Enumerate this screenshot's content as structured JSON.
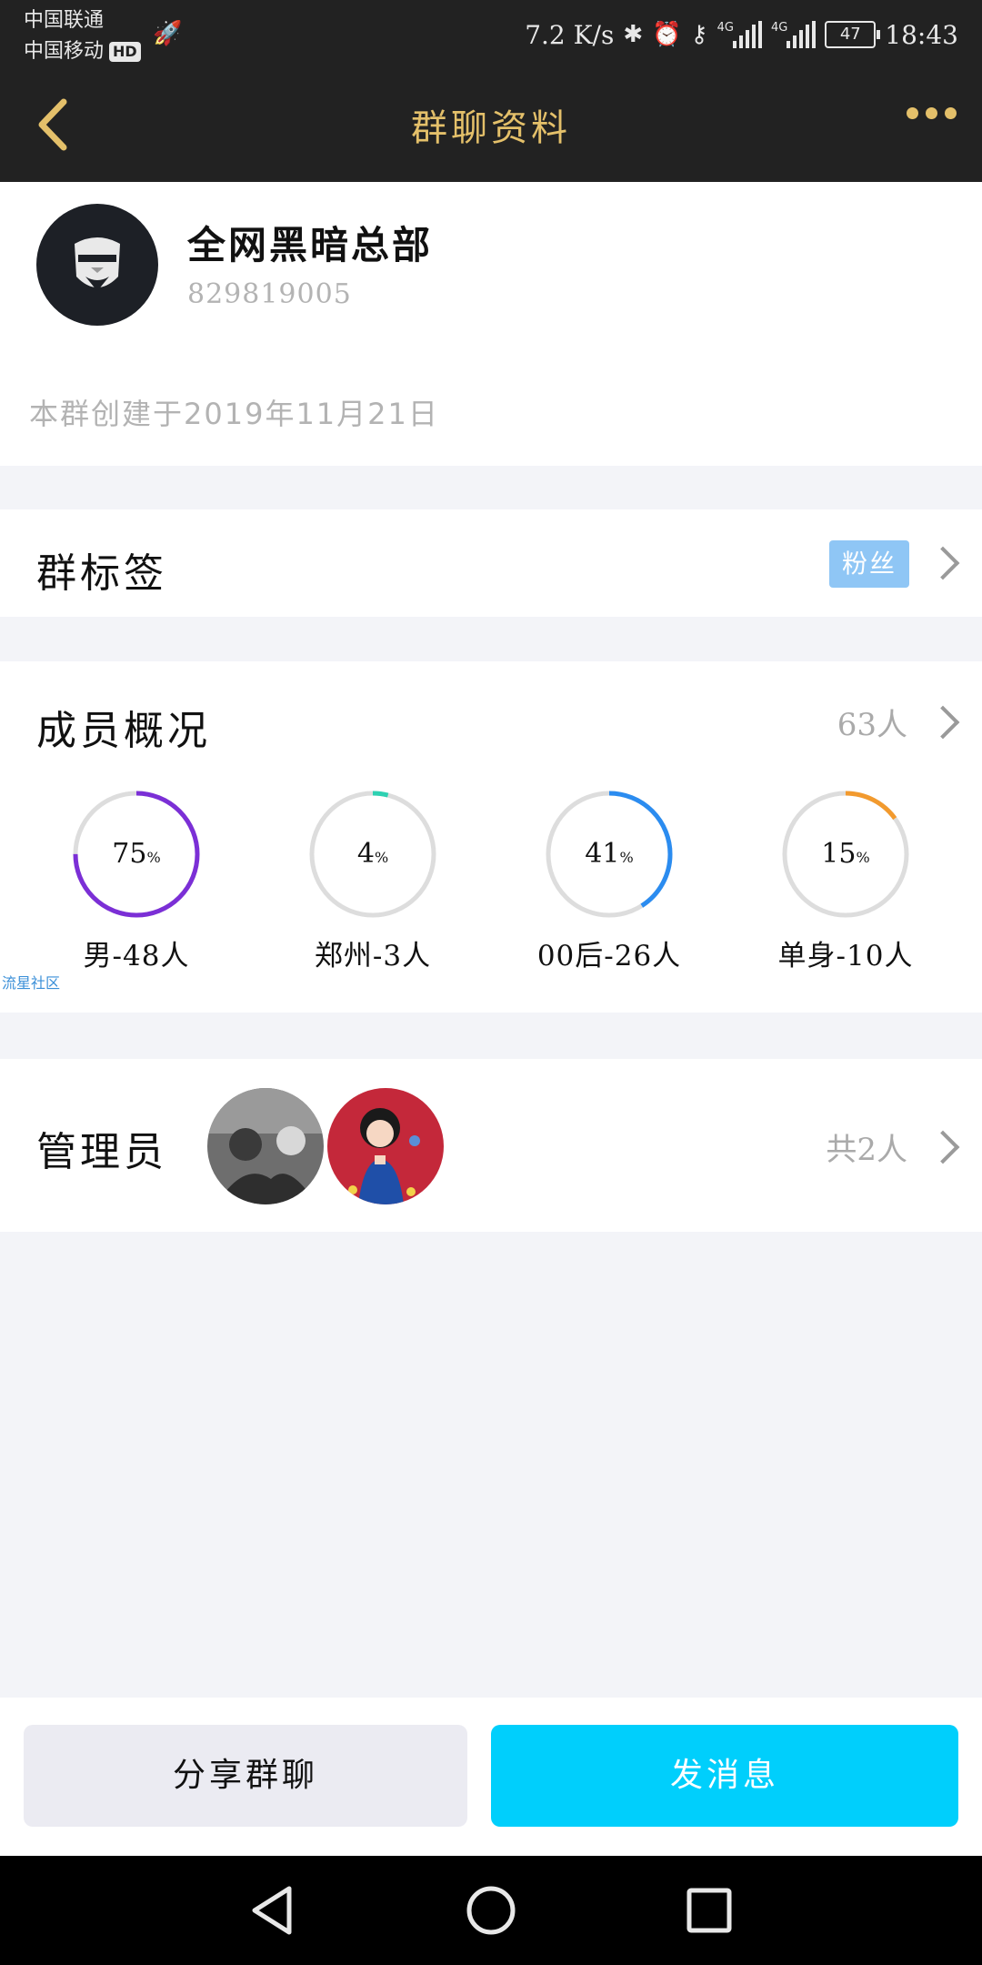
{
  "status_bar": {
    "carrier_1": "中国联通",
    "carrier_2": "中国移动",
    "hd_badge": "HD",
    "net_speed": "7.2 K/s",
    "network_1": "4G",
    "network_2": "4G",
    "battery": "47",
    "time": "18:43"
  },
  "nav": {
    "title": "群聊资料"
  },
  "group": {
    "name": "全网黑暗总部",
    "id": "829819005",
    "created": "本群创建于2019年11月21日"
  },
  "tags": {
    "title": "群标签",
    "badge": "粉丝"
  },
  "members": {
    "title": "成员概况",
    "count": "63人",
    "stats": [
      {
        "value": "75",
        "unit": "%",
        "label": "男-48人",
        "fraction": 0.75,
        "color": "#7b2fd6"
      },
      {
        "value": "4",
        "unit": "%",
        "label": "郑州-3人",
        "fraction": 0.04,
        "color": "#2ed1b2"
      },
      {
        "value": "41",
        "unit": "%",
        "label": "00后-26人",
        "fraction": 0.41,
        "color": "#2b8cf0"
      },
      {
        "value": "15",
        "unit": "%",
        "label": "单身-10人",
        "fraction": 0.15,
        "color": "#f29a2e"
      }
    ],
    "watermark": "流星社区"
  },
  "admins": {
    "title": "管理员",
    "count": "共2人"
  },
  "actions": {
    "share": "分享群聊",
    "send": "发消息"
  },
  "colors": {
    "accent_gold": "#e4c06a",
    "send_button": "#00cffc",
    "topbar": "#222222"
  }
}
